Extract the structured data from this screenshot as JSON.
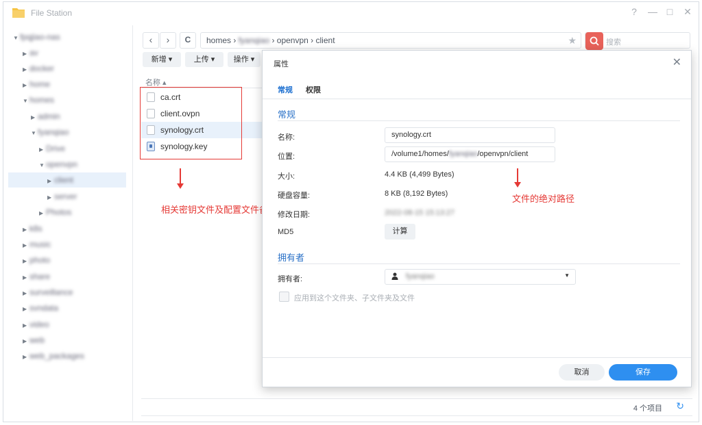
{
  "window": {
    "title": "File Station",
    "controls": [
      "?",
      "—",
      "□",
      "✕"
    ]
  },
  "sidebar": {
    "items": [
      {
        "label": "fpqjiao-nas",
        "blurred": true
      },
      {
        "label": "av",
        "blurred": true
      },
      {
        "label": "docker",
        "blurred": true
      },
      {
        "label": "home",
        "blurred": true
      },
      {
        "label": "homes",
        "blurred": true
      },
      {
        "label": "admin",
        "blurred": true
      },
      {
        "label": "fyanqiao",
        "blurred": true
      },
      {
        "label": "Drive",
        "blurred": true
      },
      {
        "label": "openvpn",
        "blurred": true
      },
      {
        "label": "client",
        "blurred": true
      },
      {
        "label": "server",
        "blurred": true
      },
      {
        "label": "Photos",
        "blurred": true
      },
      {
        "label": "k8s",
        "blurred": true
      },
      {
        "label": "music",
        "blurred": true
      },
      {
        "label": "photo",
        "blurred": true
      },
      {
        "label": "share",
        "blurred": true
      },
      {
        "label": "surveillance",
        "blurred": true
      },
      {
        "label": "svndata",
        "blurred": true
      },
      {
        "label": "video",
        "blurred": true
      },
      {
        "label": "web",
        "blurred": true
      },
      {
        "label": "web_packages",
        "blurred": true
      }
    ]
  },
  "toolbar": {
    "back": "‹",
    "forward": "›",
    "refresh": "C",
    "path_homes": "homes",
    "path_sep": "›",
    "path_user": "fyanqiao",
    "path_openvpn": "openvpn",
    "path_client": "client",
    "search_placeholder": "搜索",
    "btn_new": "新增 ▾",
    "btn_upload": "上传 ▾",
    "btn_action": "操作 ▾"
  },
  "filelist": {
    "column_name": "名称 ▴",
    "files": [
      {
        "name": "ca.crt",
        "type": "file"
      },
      {
        "name": "client.ovpn",
        "type": "file"
      },
      {
        "name": "synology.crt",
        "type": "file",
        "selected": true
      },
      {
        "name": "synology.key",
        "type": "key"
      }
    ],
    "item_count": "4 个项目"
  },
  "annotations": {
    "left_note": "相关密钥文件及配置文件备份",
    "right_note": "文件的绝对路径"
  },
  "dialog": {
    "title": "属性",
    "tabs": [
      "常规",
      "权限"
    ],
    "section_general": "常规",
    "label_name": "名称:",
    "value_name": "synology.crt",
    "label_location": "位置:",
    "value_location_prefix": "/volume1/homes/",
    "value_location_user": "fyanqiao",
    "value_location_suffix": "/openvpn/client",
    "label_size": "大小:",
    "value_size": "4.4 KB (4,499 Bytes)",
    "label_disk": "硬盘容量:",
    "value_disk": "8 KB (8,192 Bytes)",
    "label_modified": "修改日期:",
    "value_modified": "2022-08-15 15:13:27",
    "label_md5": "MD5",
    "btn_calc": "计算",
    "section_owner": "拥有者",
    "label_owner": "拥有者:",
    "value_owner": "fyanqiao",
    "apply_label": "应用到这个文件夹、子文件夹及文件",
    "btn_cancel": "取消",
    "btn_save": "保存"
  },
  "colors": {
    "accent": "#2e8ff0",
    "annotation_red": "#e53935",
    "section_blue": "#2b72c7"
  }
}
